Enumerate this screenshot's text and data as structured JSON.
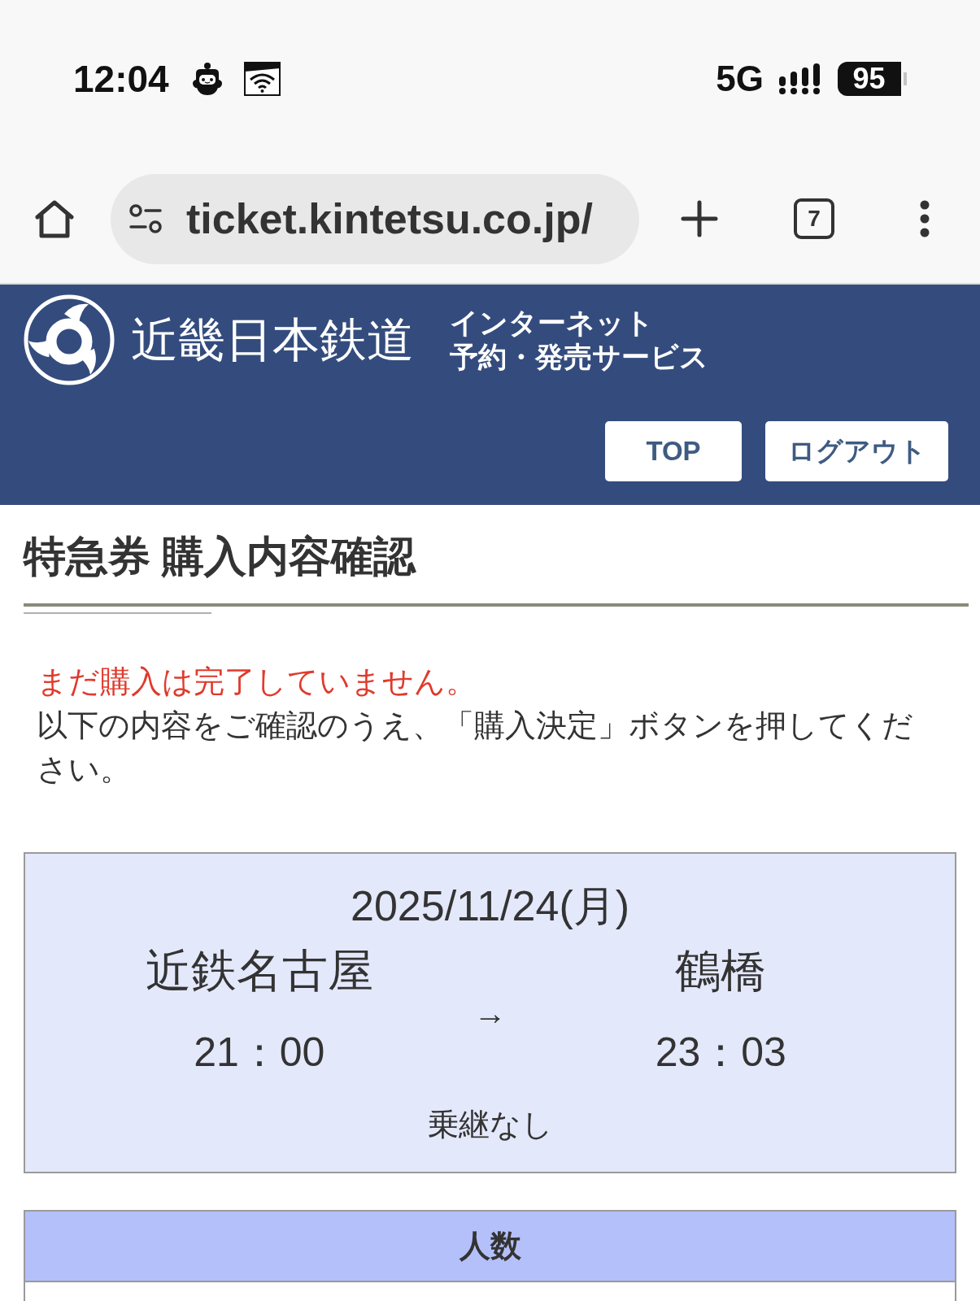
{
  "status_bar": {
    "time": "12:04",
    "network": "5G",
    "battery": "95"
  },
  "browser_bar": {
    "url": "ticket.kintetsu.co.jp/",
    "tab_count": "7"
  },
  "header": {
    "company_name": "近畿日本鉄道",
    "service_lines": [
      "インターネット",
      "予約・発売サービス"
    ],
    "buttons": [
      "TOP",
      "ログアウト"
    ]
  },
  "page_title": "特急券 購入内容確認",
  "notice": {
    "warning": "まだ購入は完了していません。",
    "instruction": "以下の内容をご確認のうえ、「購入決定」ボタンを押してください。"
  },
  "journey": {
    "date": "2025/11/24(月)",
    "departure": {
      "station": "近鉄名古屋",
      "time": "21：00"
    },
    "arrow": "→",
    "arrival": {
      "station": "鶴橋",
      "time": "23：03"
    },
    "transfer": "乗継なし"
  },
  "passengers_table": {
    "heading": "人数"
  }
}
